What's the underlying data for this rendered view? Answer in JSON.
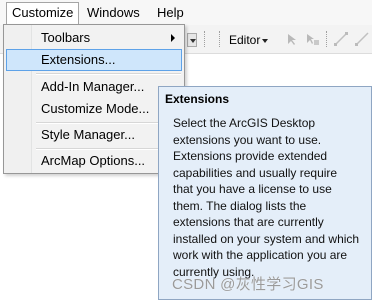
{
  "menubar": {
    "items": [
      {
        "label": "Customize"
      },
      {
        "label": "Windows"
      },
      {
        "label": "Help"
      }
    ]
  },
  "toolbar": {
    "editor_label": "Editor"
  },
  "customize_menu": {
    "items": [
      {
        "label": "Toolbars"
      },
      {
        "label": "Extensions..."
      },
      {
        "label": "Add-In Manager..."
      },
      {
        "label": "Customize Mode..."
      },
      {
        "label": "Style Manager..."
      },
      {
        "label": "ArcMap Options..."
      }
    ]
  },
  "tooltip": {
    "title": "Extensions",
    "body": "Select the ArcGIS Desktop extensions you want to use. Extensions provide extended capabilities and usually require that you have a license to use them. The dialog lists the extensions that are currently installed on your system and which work with the application you are currently using."
  },
  "watermark": "CSDN @灰性学习GIS",
  "colors": {
    "highlight_bg": "#cfe6fb",
    "highlight_border": "#5ea2e8",
    "tooltip_bg": "#e4eef9"
  }
}
